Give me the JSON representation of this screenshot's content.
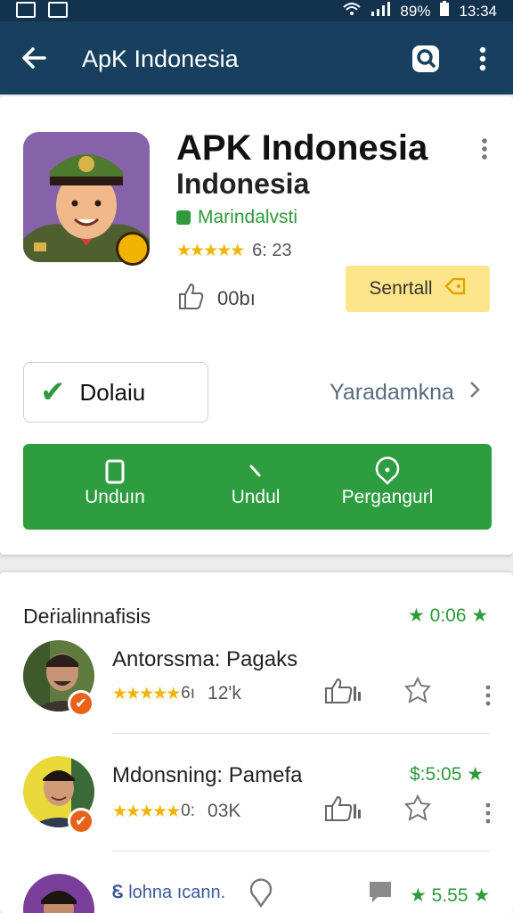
{
  "status": {
    "battery": "89%",
    "time": "13:34"
  },
  "appbar": {
    "title": "ApK Indonesia"
  },
  "app": {
    "title": "APK Indonesia",
    "subtitle": "Indonesia",
    "developer": "Marindalvsti",
    "rating_text": "6: 23",
    "likes": "00bı",
    "sentall_label": "Senrtall"
  },
  "actions": {
    "details_label": "Dolaiu",
    "right_link": "Yaradamkna",
    "bar": [
      {
        "label": "Unduın"
      },
      {
        "label": "Undul"
      },
      {
        "label": "Pergangurl"
      }
    ]
  },
  "list": {
    "header": "Deṙialinnafisis",
    "header_right": "0:06",
    "items": [
      {
        "name": "Antorssma: Pagaks",
        "stars_text": "6ı",
        "count": "12'k"
      },
      {
        "name": "Mdonsning: Pamefa",
        "stars_text": "0:",
        "count": "03K",
        "price": "$:5:05"
      },
      {
        "name": "lohna ıcann.",
        "price": "5.55"
      }
    ]
  },
  "colors": {
    "appbar": "#17405f",
    "accent_green": "#2e9d3f",
    "star": "#f2b400",
    "sentall_bg": "#fde68a"
  }
}
